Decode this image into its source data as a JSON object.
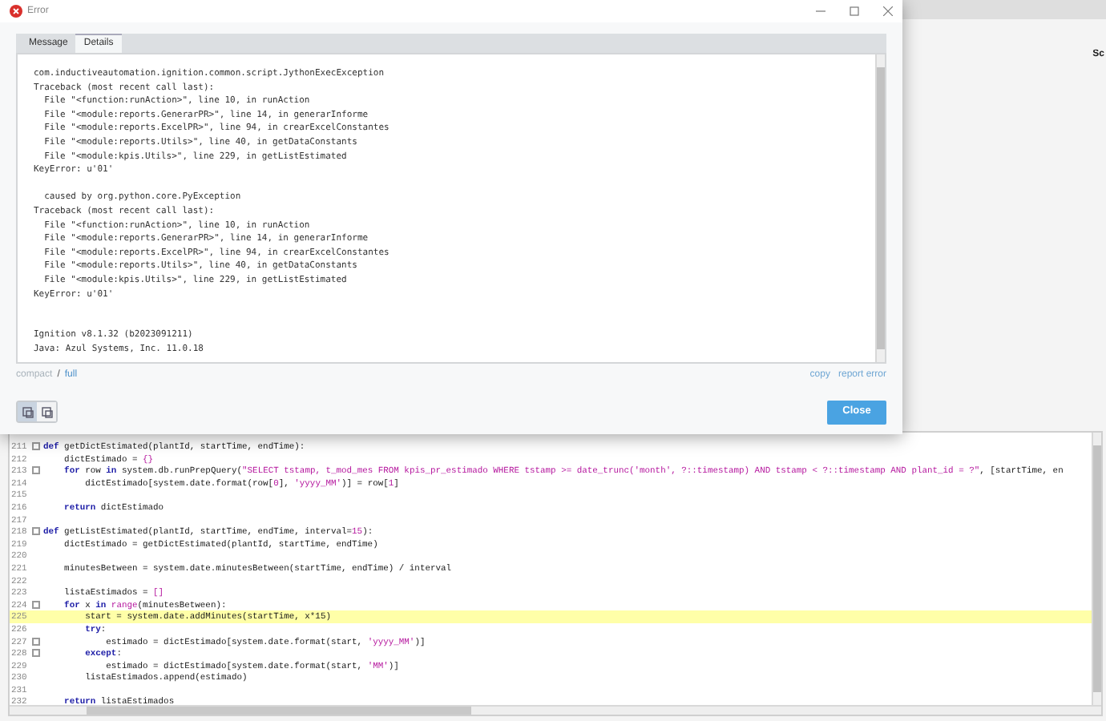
{
  "dialog": {
    "title": "Error",
    "tabs": [
      {
        "label": "Message",
        "selected": false
      },
      {
        "label": "Details",
        "selected": true
      }
    ],
    "details": "com.inductiveautomation.ignition.common.script.JythonExecException\nTraceback (most recent call last):\n  File \"<function:runAction>\", line 10, in runAction\n  File \"<module:reports.GenerarPR>\", line 14, in generarInforme\n  File \"<module:reports.ExcelPR>\", line 94, in crearExcelConstantes\n  File \"<module:reports.Utils>\", line 40, in getDataConstants\n  File \"<module:kpis.Utils>\", line 229, in getListEstimated\nKeyError: u'01'\n\n  caused by org.python.core.PyException\nTraceback (most recent call last):\n  File \"<function:runAction>\", line 10, in runAction\n  File \"<module:reports.GenerarPR>\", line 14, in generarInforme\n  File \"<module:reports.ExcelPR>\", line 94, in crearExcelConstantes\n  File \"<module:reports.Utils>\", line 40, in getDataConstants\n  File \"<module:kpis.Utils>\", line 229, in getListEstimated\nKeyError: u'01'\n\n\nIgnition v8.1.32 (b2023091211)\nJava: Azul Systems, Inc. 11.0.18",
    "view_modes": [
      {
        "label": "compact",
        "selected": false
      },
      {
        "label": "full",
        "selected": true
      }
    ],
    "view_separator": "/",
    "links": [
      "copy",
      "report error"
    ],
    "layout_toggles": [
      {
        "selected": true
      },
      {
        "selected": false
      }
    ],
    "close_button": "Close"
  },
  "side_panel": {
    "label": "Sc"
  },
  "editor": {
    "lines": [
      {
        "number": "211",
        "fold": true,
        "highlighted": false,
        "tokens": [
          {
            "kind": "kw",
            "text": "def"
          },
          {
            "kind": "plain",
            "text": " getDictEstimated(plantId, startTime, endTime):"
          }
        ]
      },
      {
        "number": "212",
        "fold": false,
        "highlighted": false,
        "tokens": [
          {
            "kind": "plain",
            "text": "    dictEstimado = "
          },
          {
            "kind": "lit",
            "text": "{}"
          }
        ]
      },
      {
        "number": "213",
        "fold": true,
        "highlighted": false,
        "tokens": [
          {
            "kind": "kw",
            "text": "    for"
          },
          {
            "kind": "plain",
            "text": " row "
          },
          {
            "kind": "kw",
            "text": "in"
          },
          {
            "kind": "plain",
            "text": " system.db.runPrepQuery("
          },
          {
            "kind": "lit",
            "text": "\"SELECT tstamp, t_mod_mes FROM kpis_pr_estimado WHERE tstamp >= date_trunc('month', ?::timestamp) AND tstamp < ?::timestamp AND plant_id = ?\""
          },
          {
            "kind": "plain",
            "text": ", [startTime, en"
          }
        ]
      },
      {
        "number": "214",
        "fold": false,
        "highlighted": false,
        "tokens": [
          {
            "kind": "plain",
            "text": "        dictEstimado[system.date.format(row["
          },
          {
            "kind": "lit",
            "text": "0"
          },
          {
            "kind": "plain",
            "text": "], "
          },
          {
            "kind": "lit",
            "text": "'yyyy_MM'"
          },
          {
            "kind": "plain",
            "text": ")] = row["
          },
          {
            "kind": "lit",
            "text": "1"
          },
          {
            "kind": "plain",
            "text": "]"
          }
        ]
      },
      {
        "number": "215",
        "fold": false,
        "highlighted": false
      },
      {
        "number": "216",
        "fold": false,
        "highlighted": false,
        "tokens": [
          {
            "kind": "kw",
            "text": "    return"
          },
          {
            "kind": "plain",
            "text": " dictEstimado"
          }
        ]
      },
      {
        "number": "217",
        "fold": false,
        "highlighted": false
      },
      {
        "number": "218",
        "fold": true,
        "highlighted": false,
        "tokens": [
          {
            "kind": "kw",
            "text": "def"
          },
          {
            "kind": "plain",
            "text": " getListEstimated(plantId, startTime, endTime, interval="
          },
          {
            "kind": "lit",
            "text": "15"
          },
          {
            "kind": "plain",
            "text": "):"
          }
        ]
      },
      {
        "number": "219",
        "fold": false,
        "highlighted": false,
        "tokens": [
          {
            "kind": "plain",
            "text": "    dictEstimado = getDictEstimated(plantId, startTime, endTime)"
          }
        ]
      },
      {
        "number": "220",
        "fold": false,
        "highlighted": false
      },
      {
        "number": "221",
        "fold": false,
        "highlighted": false,
        "tokens": [
          {
            "kind": "plain",
            "text": "    minutesBetween = system.date.minutesBetween(startTime, endTime) / interval"
          }
        ]
      },
      {
        "number": "222",
        "fold": false,
        "highlighted": false
      },
      {
        "number": "223",
        "fold": false,
        "highlighted": false,
        "tokens": [
          {
            "kind": "plain",
            "text": "    listaEstimados = "
          },
          {
            "kind": "lit",
            "text": "[]"
          }
        ]
      },
      {
        "number": "224",
        "fold": true,
        "highlighted": false,
        "tokens": [
          {
            "kind": "kw",
            "text": "    for"
          },
          {
            "kind": "plain",
            "text": " x "
          },
          {
            "kind": "kw",
            "text": "in"
          },
          {
            "kind": "lit",
            "text": " range"
          },
          {
            "kind": "plain",
            "text": "(minutesBetween):"
          }
        ]
      },
      {
        "number": "225",
        "fold": false,
        "highlighted": true,
        "tokens": [
          {
            "kind": "plain",
            "text": "        start = system.date.addMinutes(startTime, x*15)"
          }
        ]
      },
      {
        "number": "226",
        "fold": false,
        "highlighted": false,
        "tokens": [
          {
            "kind": "kw",
            "text": "        try"
          },
          {
            "kind": "plain",
            "text": ":"
          }
        ]
      },
      {
        "number": "227",
        "fold": true,
        "highlighted": false,
        "tokens": [
          {
            "kind": "plain",
            "text": "            estimado = dictEstimado[system.date.format(start, "
          },
          {
            "kind": "lit",
            "text": "'yyyy_MM'"
          },
          {
            "kind": "plain",
            "text": ")]"
          }
        ]
      },
      {
        "number": "228",
        "fold": true,
        "highlighted": false,
        "tokens": [
          {
            "kind": "kw",
            "text": "        except"
          },
          {
            "kind": "plain",
            "text": ":"
          }
        ]
      },
      {
        "number": "229",
        "fold": false,
        "highlighted": false,
        "tokens": [
          {
            "kind": "plain",
            "text": "            estimado = dictEstimado[system.date.format(start, "
          },
          {
            "kind": "lit",
            "text": "'MM'"
          },
          {
            "kind": "plain",
            "text": ")]"
          }
        ]
      },
      {
        "number": "230",
        "fold": false,
        "highlighted": false,
        "tokens": [
          {
            "kind": "plain",
            "text": "        listaEstimados.append(estimado)"
          }
        ]
      },
      {
        "number": "231",
        "fold": false,
        "highlighted": false
      },
      {
        "number": "232",
        "fold": false,
        "highlighted": false,
        "tokens": [
          {
            "kind": "kw",
            "text": "    return"
          },
          {
            "kind": "plain",
            "text": " listaEstimados"
          }
        ]
      }
    ]
  }
}
